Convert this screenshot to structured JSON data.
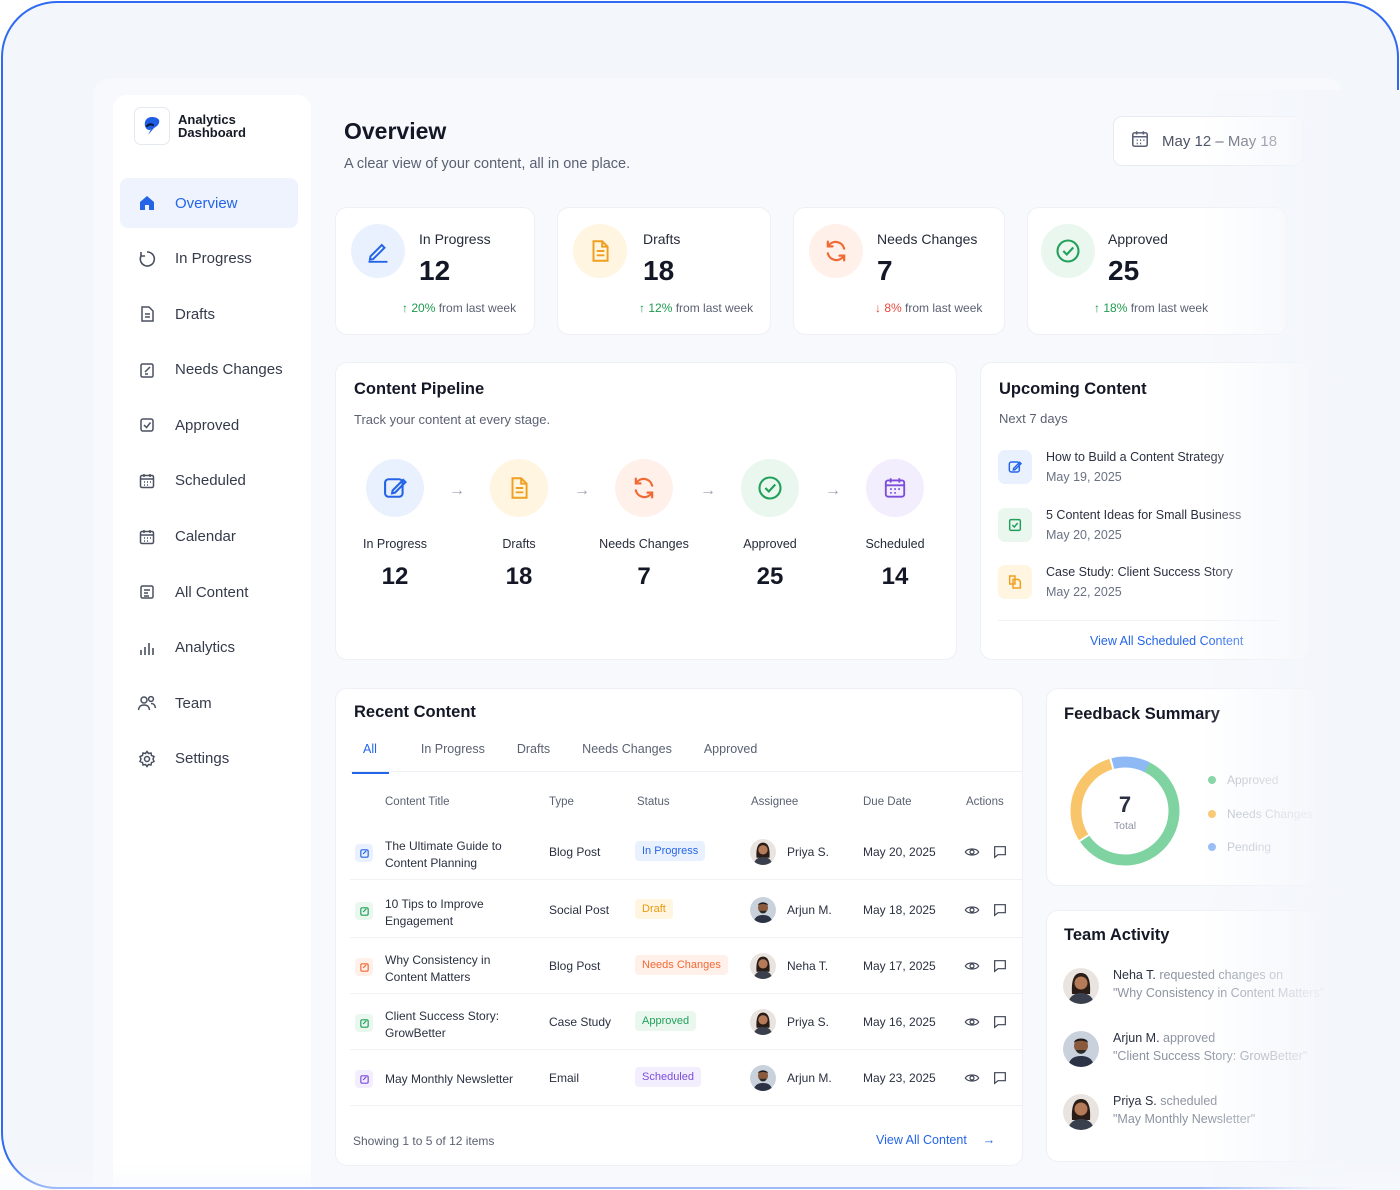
{
  "app": {
    "logo_line1": "Analytics",
    "logo_line2": "Dashboard"
  },
  "sidebar": {
    "items": [
      {
        "label": "Overview",
        "icon": "home-icon",
        "active": true
      },
      {
        "label": "In Progress",
        "icon": "progress-icon"
      },
      {
        "label": "Drafts",
        "icon": "document-icon"
      },
      {
        "label": "Needs Changes",
        "icon": "edit-document-icon"
      },
      {
        "label": "Approved",
        "icon": "check-square-icon"
      },
      {
        "label": "Scheduled",
        "icon": "calendar-icon"
      },
      {
        "label": "Calendar",
        "icon": "calendar-icon"
      },
      {
        "label": "All Content",
        "icon": "list-icon"
      },
      {
        "label": "Analytics",
        "icon": "bar-chart-icon"
      },
      {
        "label": "Team",
        "icon": "users-icon"
      },
      {
        "label": "Settings",
        "icon": "gear-icon"
      }
    ]
  },
  "header": {
    "title": "Overview",
    "subtitle": "A clear view of your content, all in one place.",
    "date_range": "May 12 – May 18"
  },
  "stats": [
    {
      "label": "In Progress",
      "value": "12",
      "trend_dir": "up",
      "trend_pct": "20%",
      "trend_text": "from last week",
      "color": "#2465e8",
      "bg": "#eaf1fe"
    },
    {
      "label": "Drafts",
      "value": "18",
      "trend_dir": "up",
      "trend_pct": "12%",
      "trend_text": "from last week",
      "color": "#f0a020",
      "bg": "#fff5e0"
    },
    {
      "label": "Needs Changes",
      "value": "7",
      "trend_dir": "down",
      "trend_pct": "8%",
      "trend_text": "from last week",
      "color": "#f06a35",
      "bg": "#fff0ea"
    },
    {
      "label": "Approved",
      "value": "25",
      "trend_dir": "up",
      "trend_pct": "18%",
      "trend_text": "from last week",
      "color": "#22a05a",
      "bg": "#e9f7ef"
    }
  ],
  "pipeline": {
    "title": "Content Pipeline",
    "subtitle": "Track your content at every stage.",
    "stages": [
      {
        "name": "In Progress",
        "count": "12",
        "color": "#2465e8",
        "bg": "#eaf1fe"
      },
      {
        "name": "Drafts",
        "count": "18",
        "color": "#f0a020",
        "bg": "#fff5e0"
      },
      {
        "name": "Needs Changes",
        "count": "7",
        "color": "#f06a35",
        "bg": "#fff0ea"
      },
      {
        "name": "Approved",
        "count": "25",
        "color": "#22a05a",
        "bg": "#e9f7ef"
      },
      {
        "name": "Scheduled",
        "count": "14",
        "color": "#7c4ddb",
        "bg": "#f3eefd"
      }
    ]
  },
  "upcoming": {
    "title": "Upcoming Content",
    "subtitle": "Next 7 days",
    "items": [
      {
        "title": "How to Build a Content Strategy",
        "date": "May 19, 2025",
        "color": "#2465e8",
        "bg": "#eaf1fe"
      },
      {
        "title": "5 Content Ideas for Small Business",
        "date": "May 20, 2025",
        "color": "#22a05a",
        "bg": "#e9f7ef"
      },
      {
        "title": "Case Study: Client Success Story",
        "date": "May 22, 2025",
        "color": "#f0a020",
        "bg": "#fff5e0"
      }
    ],
    "link": "View All Scheduled Content"
  },
  "recent": {
    "title": "Recent Content",
    "tabs": [
      "All",
      "In Progress",
      "Drafts",
      "Needs Changes",
      "Approved"
    ],
    "columns": [
      "Content Title",
      "Type",
      "Status",
      "Assignee",
      "Due Date",
      "Actions"
    ],
    "rows": [
      {
        "title1": "The Ultimate Guide to",
        "title2": "Content Planning",
        "type": "Blog Post",
        "status": "In Progress",
        "status_color": "#2465e8",
        "status_bg": "#eaf1fe",
        "assignee": "Priya S.",
        "due": "May 20, 2025",
        "icon_color": "#2465e8",
        "icon_bg": "#eaf1fe",
        "gender": "f"
      },
      {
        "title1": "10 Tips to Improve",
        "title2": "Engagement",
        "type": "Social Post",
        "status": "Draft",
        "status_color": "#e89a12",
        "status_bg": "#fff5e0",
        "assignee": "Arjun M.",
        "due": "May 18, 2025",
        "icon_color": "#22a05a",
        "icon_bg": "#e9f7ef",
        "gender": "m"
      },
      {
        "title1": "Why Consistency in",
        "title2": "Content Matters",
        "type": "Blog Post",
        "status": "Needs Changes",
        "status_color": "#f06a35",
        "status_bg": "#fff0ea",
        "assignee": "Neha T.",
        "due": "May 17, 2025",
        "icon_color": "#f06a35",
        "icon_bg": "#fff0ea",
        "gender": "f"
      },
      {
        "title1": "Client Success Story:",
        "title2": "GrowBetter",
        "type": "Case Study",
        "status": "Approved",
        "status_color": "#22a05a",
        "status_bg": "#e9f7ef",
        "assignee": "Priya S.",
        "due": "May 16, 2025",
        "icon_color": "#22a05a",
        "icon_bg": "#e9f7ef",
        "gender": "f"
      },
      {
        "title1": "May Monthly Newsletter",
        "title2": "",
        "type": "Email",
        "status": "Scheduled",
        "status_color": "#7c4ddb",
        "status_bg": "#f3eefd",
        "assignee": "Arjun M.",
        "due": "May 23, 2025",
        "icon_color": "#7c4ddb",
        "icon_bg": "#f3eefd",
        "gender": "m"
      }
    ],
    "footer_text": "Showing 1 to 5 of 12 items",
    "footer_link": "View All Content"
  },
  "feedback": {
    "title": "Feedback Summary",
    "total": "7",
    "total_label": "Total",
    "legend": [
      "Approved",
      "Needs Changes",
      "Pending"
    ],
    "colors": [
      "#7fd3a0",
      "#f8c56a",
      "#8fb9f4"
    ]
  },
  "activity": {
    "title": "Team Activity",
    "items": [
      {
        "name": "Neha T.",
        "action": "requested changes on",
        "target": "\"Why Consistency in Content Matters\"",
        "gender": "f"
      },
      {
        "name": "Arjun M.",
        "action": "approved",
        "target": "\"Client Success Story: GrowBetter\"",
        "gender": "m"
      },
      {
        "name": "Priya S.",
        "action": "scheduled",
        "target": "\"May Monthly Newsletter\"",
        "gender": "f"
      }
    ]
  }
}
